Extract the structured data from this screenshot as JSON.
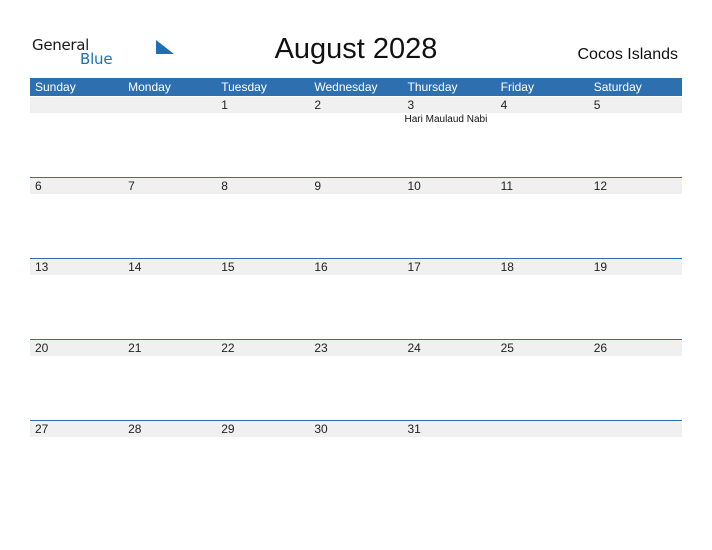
{
  "logo": {
    "word1": "General",
    "word2": "Blue"
  },
  "title": "August 2028",
  "country": "Cocos Islands",
  "colors": {
    "accent": "#2e6fb0",
    "logo_blue": "#1f6fb5",
    "day_bar": "#f0f0f0"
  },
  "weekdays": [
    "Sunday",
    "Monday",
    "Tuesday",
    "Wednesday",
    "Thursday",
    "Friday",
    "Saturday"
  ],
  "weeks": [
    [
      {
        "day": ""
      },
      {
        "day": ""
      },
      {
        "day": "1"
      },
      {
        "day": "2"
      },
      {
        "day": "3",
        "event": "Hari Maulaud Nabi"
      },
      {
        "day": "4"
      },
      {
        "day": "5"
      }
    ],
    [
      {
        "day": "6"
      },
      {
        "day": "7"
      },
      {
        "day": "8"
      },
      {
        "day": "9"
      },
      {
        "day": "10"
      },
      {
        "day": "11"
      },
      {
        "day": "12"
      }
    ],
    [
      {
        "day": "13"
      },
      {
        "day": "14"
      },
      {
        "day": "15"
      },
      {
        "day": "16"
      },
      {
        "day": "17"
      },
      {
        "day": "18"
      },
      {
        "day": "19"
      }
    ],
    [
      {
        "day": "20"
      },
      {
        "day": "21"
      },
      {
        "day": "22"
      },
      {
        "day": "23"
      },
      {
        "day": "24"
      },
      {
        "day": "25"
      },
      {
        "day": "26"
      }
    ],
    [
      {
        "day": "27"
      },
      {
        "day": "28"
      },
      {
        "day": "29"
      },
      {
        "day": "30"
      },
      {
        "day": "31"
      },
      {
        "day": ""
      },
      {
        "day": ""
      }
    ]
  ]
}
